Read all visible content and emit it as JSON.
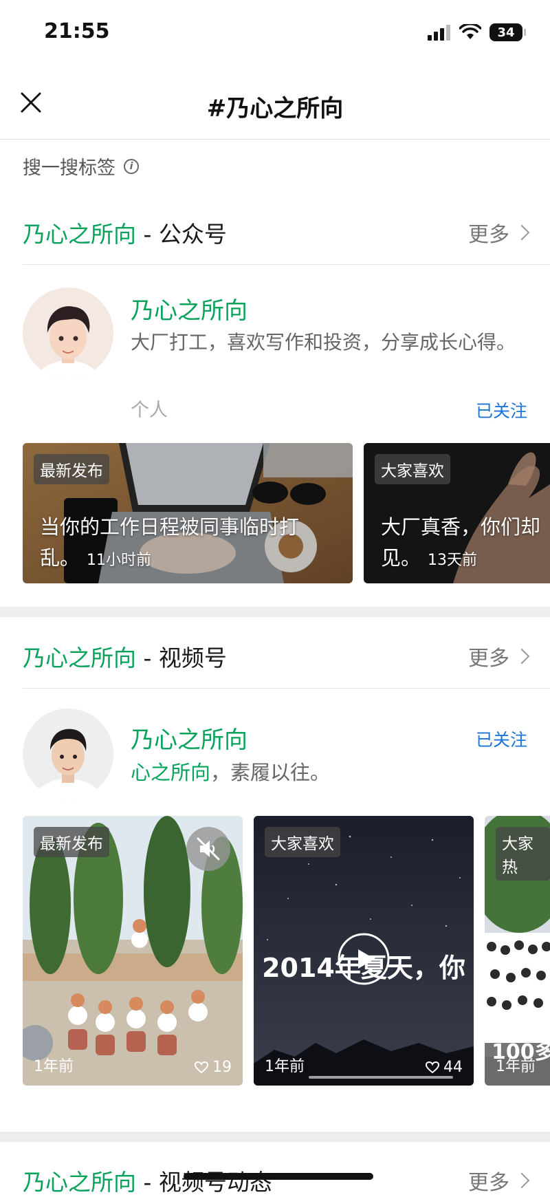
{
  "status": {
    "time": "21:55",
    "battery": "34",
    "battery_level": 0.34
  },
  "nav": {
    "title": "#乃心之所向"
  },
  "search_tag": {
    "label": "搜一搜标签"
  },
  "official": {
    "header_name": "乃心之所向",
    "header_suffix": " - 公众号",
    "more": "更多",
    "profile": {
      "name": "乃心之所向",
      "desc": "大厂打工，喜欢写作和投资，分享成长心得。",
      "type": "个人",
      "follow": "已关注"
    },
    "cards": [
      {
        "tag": "最新发布",
        "title_line1": "当你的工作日程被同事临时打",
        "title_line2": "乱。",
        "time": "11小时前"
      },
      {
        "tag": "大家喜欢",
        "title_line1": "大厂真香，你们却",
        "title_line2": "见。",
        "time": "13天前"
      }
    ]
  },
  "channels": {
    "header_name": "乃心之所向",
    "header_suffix": " - 视频号",
    "more": "更多",
    "profile": {
      "name": "乃心之所向",
      "desc_highlight": "心之所向",
      "desc_rest": "，素履以往。",
      "follow": "已关注"
    },
    "videos": [
      {
        "tag": "最新发布",
        "time": "1年前",
        "likes": "19"
      },
      {
        "tag": "大家喜欢",
        "time": "1年前",
        "likes": "44",
        "overlay_text": "2014年夏天，你"
      },
      {
        "tag": "大家热",
        "time": "1年前",
        "overlay_text": "100多"
      }
    ]
  },
  "moments": {
    "header_name": "乃心之所向",
    "header_suffix": " - 视频号动态",
    "more": "更多"
  }
}
